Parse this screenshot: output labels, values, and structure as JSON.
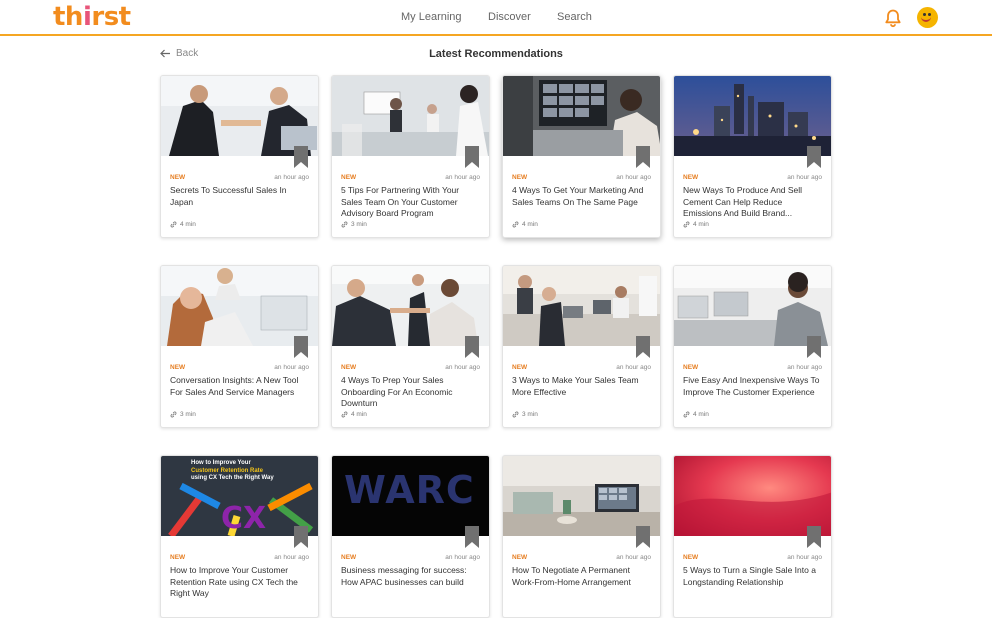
{
  "brand": {
    "logo_text_a": "th",
    "logo_text_i": "i",
    "logo_text_b": "rst"
  },
  "nav": {
    "items": [
      {
        "label": "My Learning"
      },
      {
        "label": "Discover"
      },
      {
        "label": "Search"
      }
    ]
  },
  "header_icons": {
    "notifications": "bell-icon",
    "profile": "avatar"
  },
  "page": {
    "back_label": "Back",
    "title": "Latest Recommendations"
  },
  "cards": [
    {
      "badge": "NEW",
      "time": "an hour ago",
      "title": "Secrets To Successful Sales In Japan",
      "duration": "4 min"
    },
    {
      "badge": "NEW",
      "time": "an hour ago",
      "title": "5 Tips For Partnering With Your Sales Team On Your Customer Advisory Board Program",
      "duration": "3 min"
    },
    {
      "badge": "NEW",
      "time": "an hour ago",
      "title": "4 Ways To Get Your Marketing And Sales Teams On The Same Page",
      "duration": "4 min"
    },
    {
      "badge": "NEW",
      "time": "an hour ago",
      "title": "New Ways To Produce And Sell Cement Can Help Reduce Emissions And Build Brand...",
      "duration": "4 min"
    },
    {
      "badge": "NEW",
      "time": "an hour ago",
      "title": "Conversation Insights: A New Tool For Sales And Service Managers",
      "duration": "3 min"
    },
    {
      "badge": "NEW",
      "time": "an hour ago",
      "title": "4 Ways To Prep Your Sales Onboarding For An Economic Downturn",
      "duration": "4 min"
    },
    {
      "badge": "NEW",
      "time": "an hour ago",
      "title": "3 Ways to Make Your Sales Team More Effective",
      "duration": "3 min"
    },
    {
      "badge": "NEW",
      "time": "an hour ago",
      "title": "Five Easy And Inexpensive Ways To Improve The Customer Experience",
      "duration": "4 min"
    },
    {
      "badge": "NEW",
      "time": "an hour ago",
      "title": "How to Improve Your Customer Retention Rate using CX Tech the Right Way",
      "duration": "",
      "thumb_text_a": "How to Improve Your",
      "thumb_text_b": "Customer Retention Rate",
      "thumb_text_c": "using CX Tech the Right Way"
    },
    {
      "badge": "NEW",
      "time": "an hour ago",
      "title": "Business messaging for success: How APAC businesses can build",
      "duration": "",
      "thumb_text": "WARC"
    },
    {
      "badge": "NEW",
      "time": "an hour ago",
      "title": "How To Negotiate A Permanent Work-From-Home Arrangement",
      "duration": ""
    },
    {
      "badge": "NEW",
      "time": "an hour ago",
      "title": "5 Ways to Turn a Single Sale Into a Longstanding Relationship",
      "duration": ""
    }
  ],
  "colors": {
    "accent": "#f5a623",
    "badge": "#e67e22",
    "logo": "#f28c1e"
  }
}
